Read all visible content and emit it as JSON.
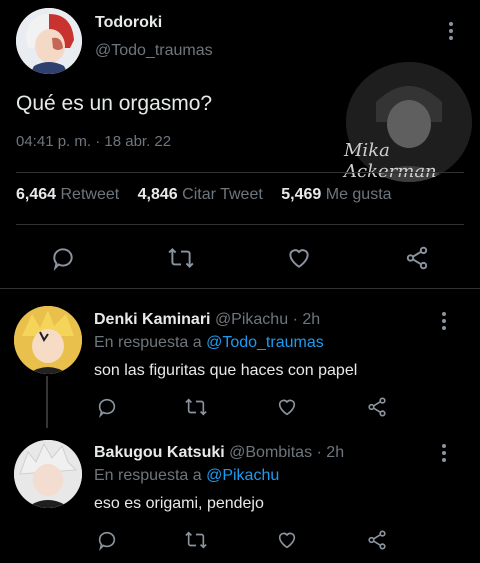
{
  "main_tweet": {
    "display_name": "Todoroki",
    "handle": "@Todo_traumas",
    "text": "Qué es un orgasmo?",
    "timestamp": "04:41 p. m. · 18 abr. 22",
    "watermark": "Mika Ackerman",
    "stats": {
      "retweets": "6,464",
      "retweets_label": "Retweet",
      "quotes": "4,846",
      "quotes_label": "Citar Tweet",
      "likes": "5,469",
      "likes_label": "Me gusta"
    }
  },
  "replies": [
    {
      "display_name": "Denki Kaminari",
      "handle": "@Pikachu",
      "time": "· 2h",
      "reply_prefix": "En respuesta a",
      "reply_to": "@Todo_traumas",
      "text": "son las figuritas que haces con papel"
    },
    {
      "display_name": "Bakugou Katsuki",
      "handle": "@Bombitas",
      "time": "· 2h",
      "reply_prefix": "En respuesta a",
      "reply_to": "@Pikachu",
      "text": "eso es origami, pendejo"
    }
  ],
  "colors": {
    "background": "#000000",
    "text": "#e7e9ea",
    "muted": "#6e767d",
    "link": "#1d9bf0",
    "divider": "#2f3336"
  }
}
